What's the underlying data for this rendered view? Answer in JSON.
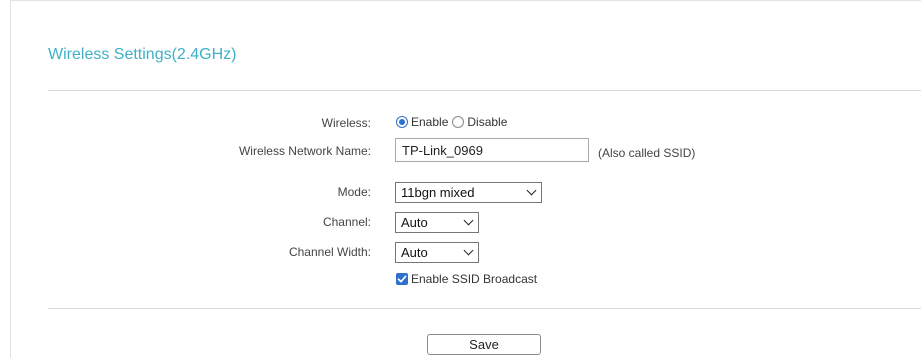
{
  "header": {
    "title": "Wireless Settings(2.4GHz)"
  },
  "form": {
    "wireless": {
      "label": "Wireless:",
      "enable_label": "Enable",
      "disable_label": "Disable",
      "selected": "Enable"
    },
    "network_name": {
      "label": "Wireless Network Name:",
      "value": "TP-Link_0969",
      "hint": "(Also called SSID)"
    },
    "mode": {
      "label": "Mode:",
      "value": "11bgn mixed"
    },
    "channel": {
      "label": "Channel:",
      "value": "Auto"
    },
    "channel_width": {
      "label": "Channel Width:",
      "value": "Auto"
    },
    "ssid_broadcast": {
      "label": "Enable SSID Broadcast",
      "checked": true
    }
  },
  "actions": {
    "save_label": "Save"
  },
  "colors": {
    "title": "#3eb1c8",
    "accent": "#2f6fd0"
  }
}
